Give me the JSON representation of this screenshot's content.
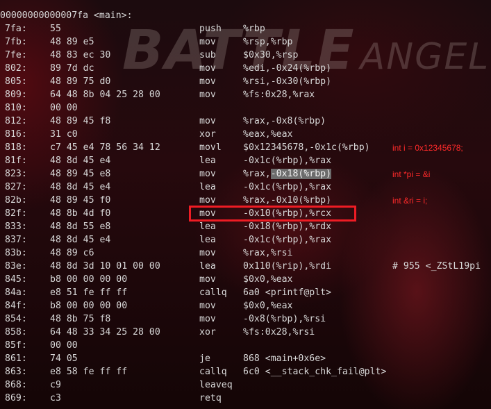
{
  "wallpaper": {
    "title_big": "BATTLE",
    "title_small": "ANGEL"
  },
  "header": "00000000000007fa <main>:",
  "lines": [
    {
      "addr": "7fa:",
      "bytes": "55",
      "mnem": "push",
      "ops": "%rbp",
      "extra": ""
    },
    {
      "addr": "7fb:",
      "bytes": "48 89 e5",
      "mnem": "mov",
      "ops": "%rsp,%rbp",
      "extra": ""
    },
    {
      "addr": "7fe:",
      "bytes": "48 83 ec 30",
      "mnem": "sub",
      "ops": "$0x30,%rsp",
      "extra": ""
    },
    {
      "addr": "802:",
      "bytes": "89 7d dc",
      "mnem": "mov",
      "ops": "%edi,-0x24(%rbp)",
      "extra": ""
    },
    {
      "addr": "805:",
      "bytes": "48 89 75 d0",
      "mnem": "mov",
      "ops": "%rsi,-0x30(%rbp)",
      "extra": ""
    },
    {
      "addr": "809:",
      "bytes": "64 48 8b 04 25 28 00",
      "mnem": "mov",
      "ops": "%fs:0x28,%rax",
      "extra": ""
    },
    {
      "addr": "810:",
      "bytes": "00 00",
      "mnem": "",
      "ops": "",
      "extra": ""
    },
    {
      "addr": "812:",
      "bytes": "48 89 45 f8",
      "mnem": "mov",
      "ops": "%rax,-0x8(%rbp)",
      "extra": ""
    },
    {
      "addr": "816:",
      "bytes": "31 c0",
      "mnem": "xor",
      "ops": "%eax,%eax",
      "extra": ""
    },
    {
      "addr": "818:",
      "bytes": "c7 45 e4 78 56 34 12",
      "mnem": "movl",
      "ops": "$0x12345678,-0x1c(%rbp)",
      "extra": ""
    },
    {
      "addr": "81f:",
      "bytes": "48 8d 45 e4",
      "mnem": "lea",
      "ops": "-0x1c(%rbp),%rax",
      "extra": ""
    },
    {
      "addr": "823:",
      "bytes": "48 89 45 e8",
      "mnem": "mov",
      "ops": "%rax,",
      "ops_sel": "-0x18(%rbp)",
      "extra": ""
    },
    {
      "addr": "827:",
      "bytes": "48 8d 45 e4",
      "mnem": "lea",
      "ops": "-0x1c(%rbp),%rax",
      "extra": ""
    },
    {
      "addr": "82b:",
      "bytes": "48 89 45 f0",
      "mnem": "mov",
      "ops": "%rax,-0x10(%rbp)",
      "extra": ""
    },
    {
      "addr": "82f:",
      "bytes": "48 8b 4d f0",
      "mnem": "mov",
      "ops": "-0x10(%rbp),%rcx",
      "extra": ""
    },
    {
      "addr": "833:",
      "bytes": "48 8d 55 e8",
      "mnem": "lea",
      "ops": "-0x18(%rbp),%rdx",
      "extra": ""
    },
    {
      "addr": "837:",
      "bytes": "48 8d 45 e4",
      "mnem": "lea",
      "ops": "-0x1c(%rbp),%rax",
      "extra": ""
    },
    {
      "addr": "83b:",
      "bytes": "48 89 c6",
      "mnem": "mov",
      "ops": "%rax,%rsi",
      "extra": ""
    },
    {
      "addr": "83e:",
      "bytes": "48 8d 3d 10 01 00 00",
      "mnem": "lea",
      "ops": "0x110(%rip),%rdi",
      "extra": "# 955 <_ZStL19pi"
    },
    {
      "addr": "845:",
      "bytes": "b8 00 00 00 00",
      "mnem": "mov",
      "ops": "$0x0,%eax",
      "extra": ""
    },
    {
      "addr": "84a:",
      "bytes": "e8 51 fe ff ff",
      "mnem": "callq",
      "ops": "6a0 <printf@plt>",
      "extra": ""
    },
    {
      "addr": "84f:",
      "bytes": "b8 00 00 00 00",
      "mnem": "mov",
      "ops": "$0x0,%eax",
      "extra": ""
    },
    {
      "addr": "854:",
      "bytes": "48 8b 75 f8",
      "mnem": "mov",
      "ops": "-0x8(%rbp),%rsi",
      "extra": ""
    },
    {
      "addr": "858:",
      "bytes": "64 48 33 34 25 28 00",
      "mnem": "xor",
      "ops": "%fs:0x28,%rsi",
      "extra": ""
    },
    {
      "addr": "85f:",
      "bytes": "00 00",
      "mnem": "",
      "ops": "",
      "extra": ""
    },
    {
      "addr": "861:",
      "bytes": "74 05",
      "mnem": "je",
      "ops": "868 <main+0x6e>",
      "extra": ""
    },
    {
      "addr": "863:",
      "bytes": "e8 58 fe ff ff",
      "mnem": "callq",
      "ops": "6c0 <__stack_chk_fail@plt>",
      "extra": ""
    },
    {
      "addr": "868:",
      "bytes": "c9",
      "mnem": "leaveq",
      "ops": "",
      "extra": ""
    },
    {
      "addr": "869:",
      "bytes": "c3",
      "mnem": "retq",
      "ops": "",
      "extra": ""
    }
  ],
  "annotations": [
    "int i = 0x12345678;",
    "int *pi = &i",
    "int &ri = i;"
  ],
  "colors": {
    "annotation": "#ff2a2a",
    "highlight_box": "#ee1c24",
    "text": "#d8d8d8",
    "selection": "#6c6c6c"
  }
}
